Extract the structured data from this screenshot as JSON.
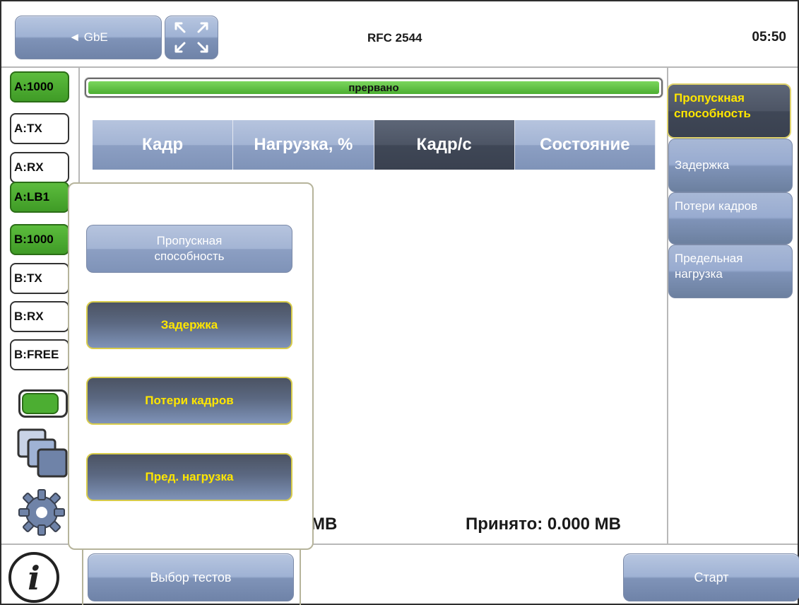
{
  "header": {
    "back_label": "◄ GbE",
    "title": "RFC 2544",
    "time": "05:50"
  },
  "sidebar": {
    "buttons": [
      {
        "label": "A:1000",
        "state": "green"
      },
      {
        "label": "A:TX",
        "state": "normal"
      },
      {
        "label": "A:RX",
        "state": "normal"
      },
      {
        "label": "A:LB1",
        "state": "green"
      },
      {
        "label": "B:1000",
        "state": "green"
      },
      {
        "label": "B:TX",
        "state": "normal"
      },
      {
        "label": "B:RX",
        "state": "normal"
      },
      {
        "label": "B:FREE",
        "state": "normal"
      }
    ],
    "toggle_on": true
  },
  "status": {
    "text": "прервано"
  },
  "table": {
    "headers": [
      "Кадр",
      "Нагрузка, %",
      "Кадр/с",
      "Состояние"
    ],
    "active_index": 2
  },
  "footer_stats": {
    "sent_tail": "MB",
    "received": "Принято: 0.000 MB"
  },
  "right_tabs": [
    "Пропускная способность",
    "Задержка",
    "Потери кадров",
    "Предельная нагрузка"
  ],
  "popup_menu": {
    "items": [
      {
        "label": "Пропускная способность",
        "selected": false
      },
      {
        "label": "Задержка",
        "selected": true
      },
      {
        "label": "Потери кадров",
        "selected": true
      },
      {
        "label": "Пред. нагрузка",
        "selected": true
      }
    ]
  },
  "bottom": {
    "select_tests_label": "Выбор тестов",
    "start_label": "Старт"
  },
  "colors": {
    "accent_green": "#4cae32",
    "accent_yellow": "#ffe600",
    "button_blue": "#9fb2d4",
    "button_dark": "#4d5565"
  }
}
